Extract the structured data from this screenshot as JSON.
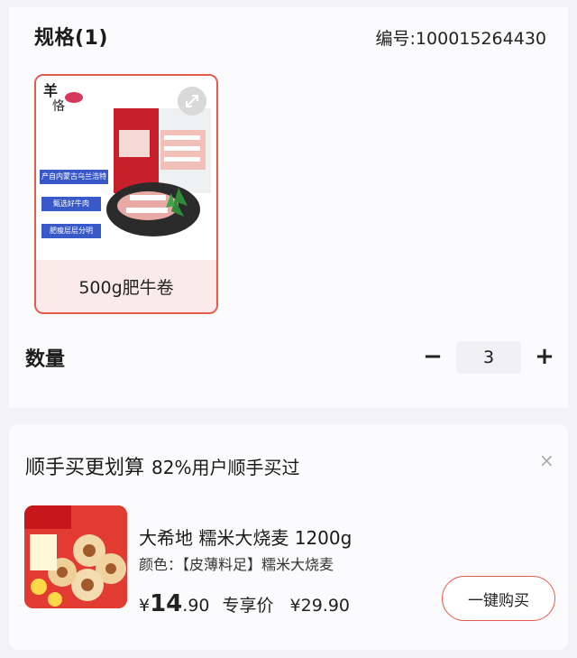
{
  "spec": {
    "title": "规格(1)",
    "sku": "编号:100015264430",
    "option_label": "500g肥牛卷",
    "image_texts": [
      "产自内蒙古乌兰浩特",
      "甄选好牛肉",
      "肥瘦层层分明"
    ]
  },
  "quantity": {
    "label": "数量",
    "minus": "−",
    "value": "3",
    "plus": "+"
  },
  "recommend": {
    "title": "顺手买更划算",
    "subtitle": "82%用户顺手买过",
    "close": "×",
    "product": {
      "name": "大希地 糯米大烧麦 1200g",
      "color": "颜色：【皮薄料足】糯米大烧麦",
      "price_symbol": "¥",
      "price_int": "14",
      "price_dec": ".90",
      "price_tag": "专享价",
      "original_price": "¥29.90",
      "buy_label": "一键购买"
    }
  },
  "colors": {
    "accent": "#e45a4d",
    "label_bg": "#fbeaea"
  }
}
